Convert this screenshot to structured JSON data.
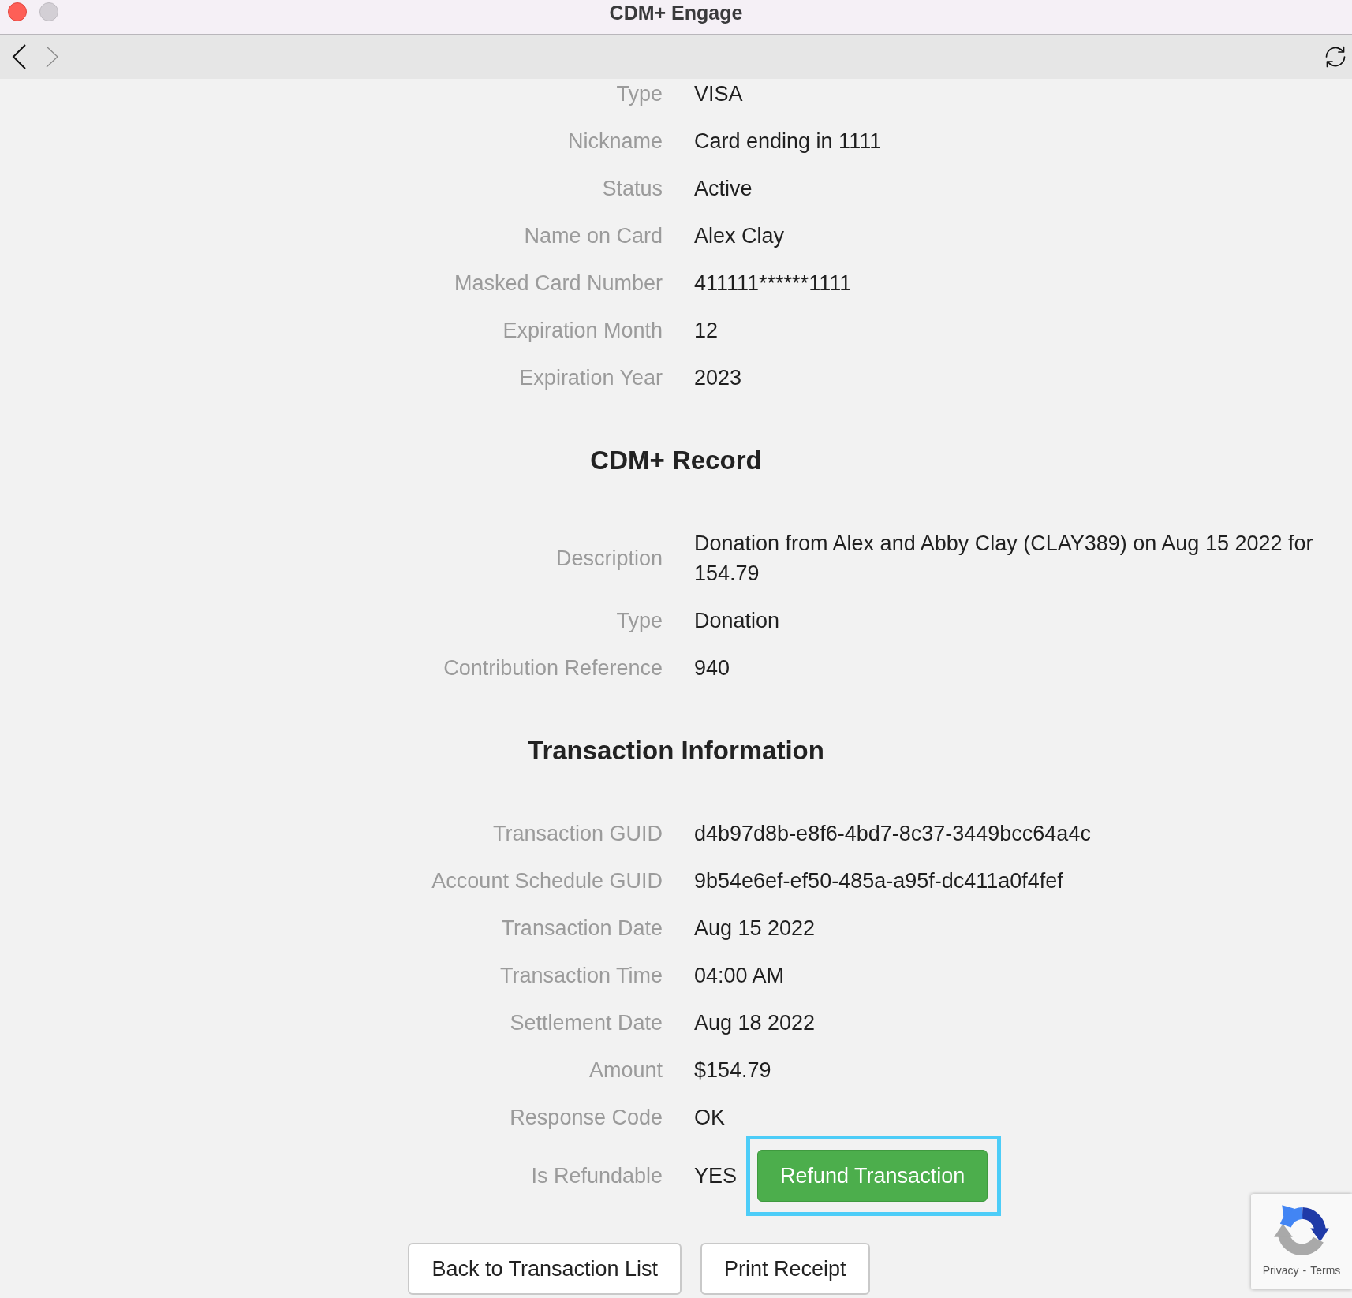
{
  "window": {
    "title": "CDM+ Engage"
  },
  "toolbar": {
    "back": {
      "disabled": false
    },
    "forward": {
      "disabled": true
    }
  },
  "sections": [
    {
      "rows": [
        {
          "label": "Type",
          "value": "VISA"
        },
        {
          "label": "Nickname",
          "value": "Card ending in 1111"
        },
        {
          "label": "Status",
          "value": "Active"
        },
        {
          "label": "Name on Card",
          "value": "Alex Clay"
        },
        {
          "label": "Masked Card Number",
          "value": "411111******1111"
        },
        {
          "label": "Expiration Month",
          "value": "12"
        },
        {
          "label": "Expiration Year",
          "value": "2023"
        }
      ]
    },
    {
      "heading": "CDM+ Record",
      "rows": [
        {
          "label": "Description",
          "value": "Donation from Alex and Abby Clay (CLAY389) on Aug 15 2022 for 154.79"
        },
        {
          "label": "Type",
          "value": "Donation"
        },
        {
          "label": "Contribution Reference",
          "value": "940"
        }
      ]
    },
    {
      "heading": "Transaction Information",
      "rows": [
        {
          "label": "Transaction GUID",
          "value": "d4b97d8b-e8f6-4bd7-8c37-3449bcc64a4c"
        },
        {
          "label": "Account Schedule GUID",
          "value": "9b54e6ef-ef50-485a-a95f-dc411a0f4fef"
        },
        {
          "label": "Transaction Date",
          "value": "Aug 15 2022"
        },
        {
          "label": "Transaction Time",
          "value": "04:00 AM"
        },
        {
          "label": "Settlement Date",
          "value": "Aug 18 2022"
        },
        {
          "label": "Amount",
          "value": "$154.79"
        },
        {
          "label": "Response Code",
          "value": "OK"
        },
        {
          "label": "Is Refundable",
          "value": "YES",
          "action": {
            "label": "Refund Transaction",
            "highlighted": true
          }
        }
      ]
    }
  ],
  "buttons": [
    {
      "label": "Back to Transaction List"
    },
    {
      "label": "Print Receipt"
    }
  ],
  "captcha_badge": {
    "links": [
      {
        "label": "Privacy"
      },
      {
        "label": "Terms"
      }
    ],
    "separator": "-"
  }
}
